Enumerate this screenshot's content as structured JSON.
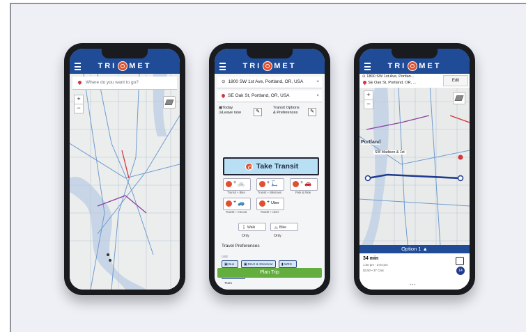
{
  "brand": {
    "name": "TRI",
    "name2": "MET"
  },
  "phone1": {
    "search_placeholder": "Where do you want to go?",
    "zoom_in": "+",
    "zoom_out": "−"
  },
  "phone2": {
    "from": "1800 SW 1st Ave, Portland, OR, USA",
    "to": "SE Oak St, Portland, OR, USA",
    "clear": "×",
    "date_label": "Today",
    "time_label": "Leave now",
    "transit_options": "Transit Options",
    "preferences": "& Preferences",
    "take_transit": "Take Transit",
    "modes": [
      {
        "glyph": "🚲",
        "caption": "Transit + Bike"
      },
      {
        "glyph": "🛴",
        "caption": "Transit + Biketown"
      },
      {
        "glyph": "🚗",
        "caption": "Park & Ride"
      },
      {
        "glyph": "🚙",
        "caption": "Transit + eScoot"
      },
      {
        "glyph": "Uber",
        "caption": "Transit + Uber"
      }
    ],
    "walk_only": "Walk Only",
    "bike_only": "Bike Only",
    "travel_prefs": "Travel Preferences",
    "use": "USE",
    "prefs": [
      "Bus",
      "MAX & Streetcar",
      "WES",
      "Aerial Tram"
    ],
    "plan_trip": "Plan Trip"
  },
  "phone3": {
    "from": "1800 SW 1st Ave, Portlan...",
    "to": "SE Oak St, Portland, OR, ...",
    "edit": "Edit",
    "city": "Portland",
    "street": "SW Madison & 1st",
    "option": "Option 1 ▲",
    "duration": "34 min",
    "times": "1:30 pm - 2:04 pm",
    "fare": "$2.50 • 37 Cals",
    "route": "14"
  }
}
